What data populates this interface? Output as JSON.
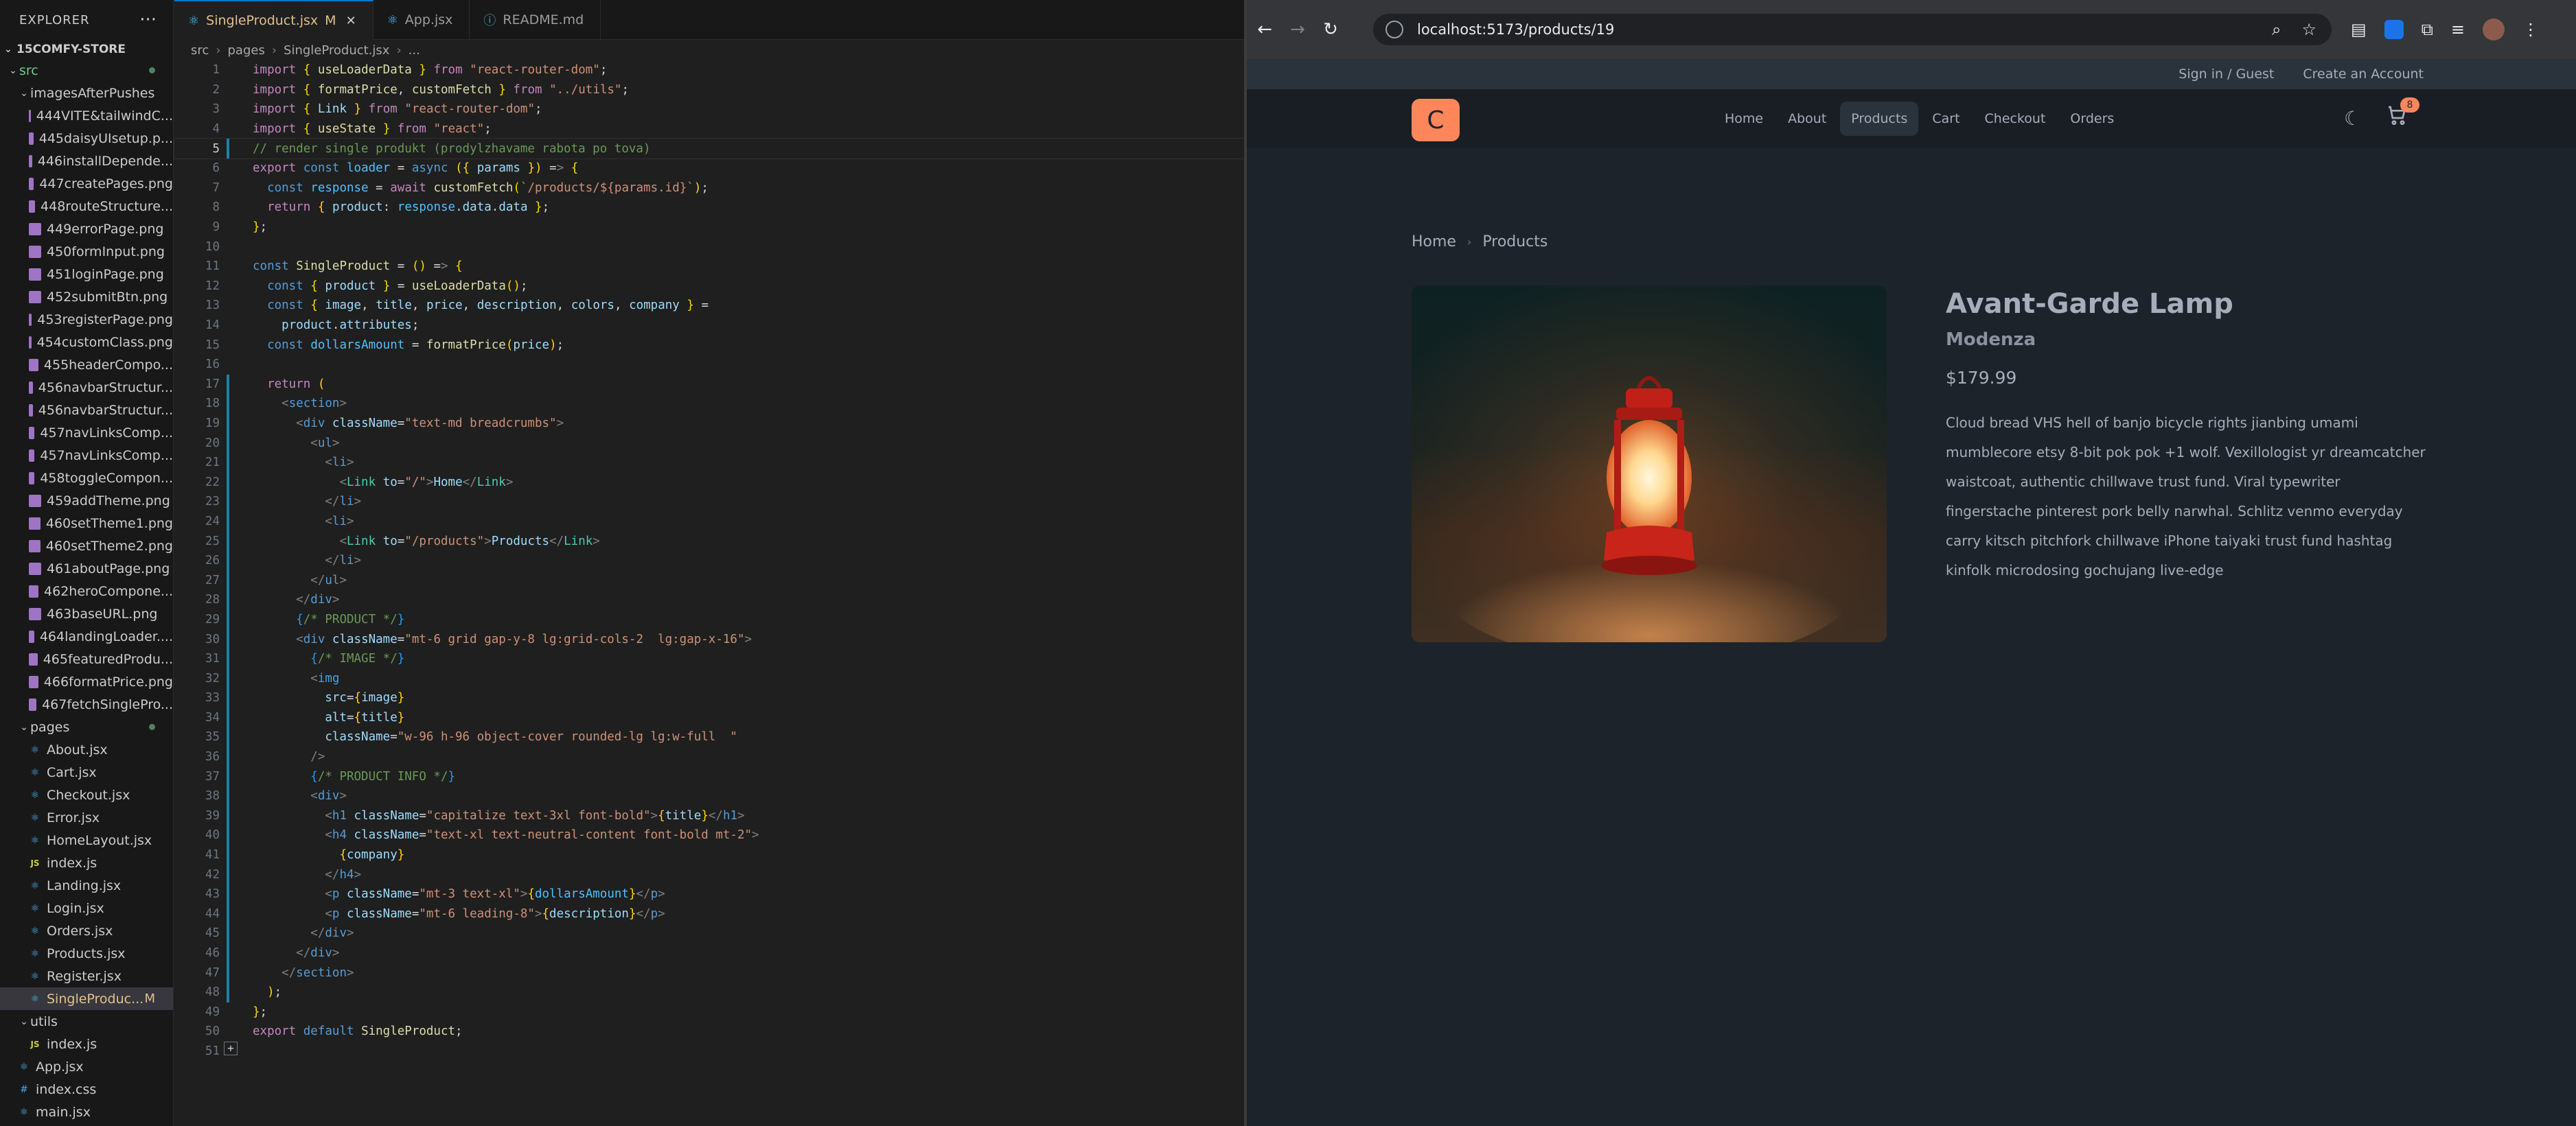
{
  "vscode": {
    "explorer_title": "EXPLORER",
    "project": "15COMFY-STORE",
    "tree": [
      {
        "label": "src",
        "kind": "folder",
        "depth": 0,
        "open": true,
        "dot": true
      },
      {
        "label": "imagesAfterPushes",
        "kind": "folder",
        "depth": 1,
        "open": true
      },
      {
        "label": "444VITE&tailwindC...",
        "kind": "png",
        "depth": 2
      },
      {
        "label": "445daisyUIsetup.p...",
        "kind": "png",
        "depth": 2
      },
      {
        "label": "446installDepende...",
        "kind": "png",
        "depth": 2
      },
      {
        "label": "447createPages.png",
        "kind": "png",
        "depth": 2
      },
      {
        "label": "448routeStructure...",
        "kind": "png",
        "depth": 2
      },
      {
        "label": "449errorPage.png",
        "kind": "png",
        "depth": 2
      },
      {
        "label": "450formInput.png",
        "kind": "png",
        "depth": 2
      },
      {
        "label": "451loginPage.png",
        "kind": "png",
        "depth": 2
      },
      {
        "label": "452submitBtn.png",
        "kind": "png",
        "depth": 2
      },
      {
        "label": "453registerPage.png",
        "kind": "png",
        "depth": 2
      },
      {
        "label": "454customClass.png",
        "kind": "png",
        "depth": 2
      },
      {
        "label": "455headerCompo...",
        "kind": "png",
        "depth": 2
      },
      {
        "label": "456navbarStructur...",
        "kind": "png",
        "depth": 2
      },
      {
        "label": "456navbarStructur...",
        "kind": "png",
        "depth": 2
      },
      {
        "label": "457navLinksComp...",
        "kind": "png",
        "depth": 2
      },
      {
        "label": "457navLinksComp...",
        "kind": "png",
        "depth": 2
      },
      {
        "label": "458toggleCompon...",
        "kind": "png",
        "depth": 2
      },
      {
        "label": "459addTheme.png",
        "kind": "png",
        "depth": 2
      },
      {
        "label": "460setTheme1.png",
        "kind": "png",
        "depth": 2
      },
      {
        "label": "460setTheme2.png",
        "kind": "png",
        "depth": 2
      },
      {
        "label": "461aboutPage.png",
        "kind": "png",
        "depth": 2
      },
      {
        "label": "462heroCompone...",
        "kind": "png",
        "depth": 2
      },
      {
        "label": "463baseURL.png",
        "kind": "png",
        "depth": 2
      },
      {
        "label": "464landingLoader....",
        "kind": "png",
        "depth": 2
      },
      {
        "label": "465featuredProdu...",
        "kind": "png",
        "depth": 2
      },
      {
        "label": "466formatPrice.png",
        "kind": "png",
        "depth": 2
      },
      {
        "label": "467fetchSinglePro...",
        "kind": "png",
        "depth": 2
      },
      {
        "label": "pages",
        "kind": "folder",
        "depth": 1,
        "open": true,
        "dot": true
      },
      {
        "label": "About.jsx",
        "kind": "jsx",
        "depth": 2
      },
      {
        "label": "Cart.jsx",
        "kind": "jsx",
        "depth": 2
      },
      {
        "label": "Checkout.jsx",
        "kind": "jsx",
        "depth": 2
      },
      {
        "label": "Error.jsx",
        "kind": "jsx",
        "depth": 2
      },
      {
        "label": "HomeLayout.jsx",
        "kind": "jsx",
        "depth": 2
      },
      {
        "label": "index.js",
        "kind": "js",
        "depth": 2
      },
      {
        "label": "Landing.jsx",
        "kind": "jsx",
        "depth": 2
      },
      {
        "label": "Login.jsx",
        "kind": "jsx",
        "depth": 2
      },
      {
        "label": "Orders.jsx",
        "kind": "jsx",
        "depth": 2
      },
      {
        "label": "Products.jsx",
        "kind": "jsx",
        "depth": 2
      },
      {
        "label": "Register.jsx",
        "kind": "jsx",
        "depth": 2
      },
      {
        "label": "SingleProduc...",
        "kind": "jsx",
        "depth": 2,
        "selected": true,
        "badge": "M"
      },
      {
        "label": "utils",
        "kind": "folder",
        "depth": 1,
        "open": true
      },
      {
        "label": "index.js",
        "kind": "js",
        "depth": 2
      },
      {
        "label": "App.jsx",
        "kind": "jsx",
        "depth": 1
      },
      {
        "label": "index.css",
        "kind": "css",
        "depth": 1
      },
      {
        "label": "main.jsx",
        "kind": "jsx",
        "depth": 1
      }
    ],
    "tabs": [
      {
        "label": "SingleProduct.jsx",
        "modified": "M",
        "active": true,
        "icon": "react-icon"
      },
      {
        "label": "App.jsx",
        "active": false,
        "icon": "react-icon"
      },
      {
        "label": "README.md",
        "active": false,
        "icon": "info-icon"
      }
    ],
    "breadcrumb": [
      "src",
      "pages",
      "SingleProduct.jsx",
      "..."
    ],
    "code_lines": [
      "import { useLoaderData } from \"react-router-dom\";",
      "import { formatPrice, customFetch } from \"../utils\";",
      "import { Link } from \"react-router-dom\";",
      "import { useState } from \"react\";",
      "// render single produkt (prodylzhavame rabota po tova)",
      "export const loader = async ({ params }) => {",
      "  const response = await customFetch(`/products/${params.id}`);",
      "  return { product: response.data.data };",
      "};",
      "",
      "const SingleProduct = () => {",
      "  const { product } = useLoaderData();",
      "  const { image, title, price, description, colors, company } =",
      "    product.attributes;",
      "  const dollarsAmount = formatPrice(price);",
      "",
      "  return (",
      "    <section>",
      "      <div className=\"text-md breadcrumbs\">",
      "        <ul>",
      "          <li>",
      "            <Link to=\"/\">Home</Link>",
      "          </li>",
      "          <li>",
      "            <Link to=\"/products\">Products</Link>",
      "          </li>",
      "        </ul>",
      "      </div>",
      "      {/* PRODUCT */}",
      "      <div className=\"mt-6 grid gap-y-8 lg:grid-cols-2  lg:gap-x-16\">",
      "        {/* IMAGE */}",
      "        <img",
      "          src={image}",
      "          alt={title}",
      "          className=\"w-96 h-96 object-cover rounded-lg lg:w-full  \"",
      "        />",
      "        {/* PRODUCT INFO */}",
      "        <div>",
      "          <h1 className=\"capitalize text-3xl font-bold\">{title}</h1>",
      "          <h4 className=\"text-xl text-neutral-content font-bold mt-2\">",
      "            {company}",
      "          </h4>",
      "          <p className=\"mt-3 text-xl\">{dollarsAmount}</p>",
      "          <p className=\"mt-6 leading-8\">{description}</p>",
      "        </div>",
      "      </div>",
      "    </section>",
      "  );",
      "};",
      "export default SingleProduct;",
      ""
    ],
    "current_line": 5
  },
  "browser": {
    "url": "localhost:5173/products/19",
    "site": {
      "topbar": {
        "signin": "Sign in / Guest",
        "create": "Create an Account"
      },
      "logo": "C",
      "nav": [
        "Home",
        "About",
        "Products",
        "Cart",
        "Checkout",
        "Orders"
      ],
      "active_nav": "Products",
      "cart_count": "8",
      "breadcrumbs": [
        "Home",
        "Products"
      ],
      "product": {
        "title": "Avant-Garde Lamp",
        "company": "Modenza",
        "price": "$179.99",
        "description": "Cloud bread VHS hell of banjo bicycle rights jianbing umami mumblecore etsy 8-bit pok pok +1 wolf. Vexillologist yr dreamcatcher waistcoat, authentic chillwave trust fund. Viral typewriter fingerstache pinterest pork belly narwhal. Schlitz venmo everyday carry kitsch pitchfork chillwave iPhone taiyaki trust fund hashtag kinfolk microdosing gochujang live-edge"
      }
    }
  },
  "colors": {
    "accent": "#ff865b",
    "vscode_bg": "#1f1f1f",
    "site_bg": "#1d232a",
    "modified": "#e2c08d"
  }
}
